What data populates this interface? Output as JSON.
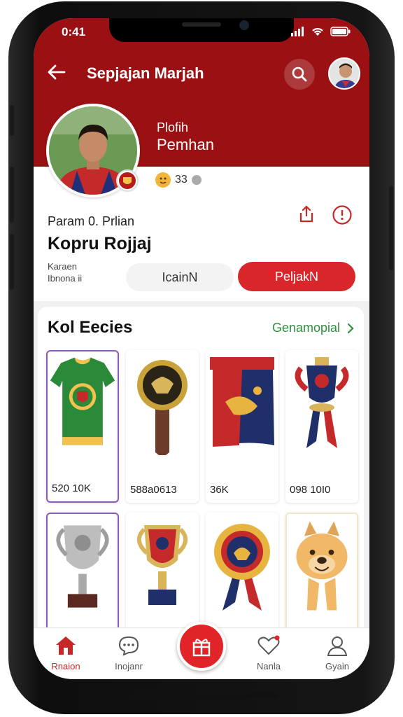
{
  "status_bar": {
    "time": "0:41"
  },
  "header": {
    "title": "Sepjajan Marjah",
    "profile_label": "Plofih",
    "profile_name": "Pemhan"
  },
  "stats": {
    "count": "33"
  },
  "profile": {
    "sub_label": "Param 0. Prlian",
    "name": "Kopru Rojjaj",
    "meta_line1": "Karaen",
    "meta_line2": "Ibnona ii"
  },
  "buttons": {
    "secondary": "IcainN",
    "primary": "PeljakN"
  },
  "collection": {
    "title": "Kol Eecies",
    "link": "Genamopial",
    "items": [
      {
        "price": "520 10K",
        "icon": "jersey-icon"
      },
      {
        "price": "588a0613",
        "icon": "medal-icon"
      },
      {
        "price": "36K",
        "icon": "flag-icon"
      },
      {
        "price": "098 10I0",
        "icon": "trophy-ribbon-icon"
      },
      {
        "price": "",
        "icon": "silver-trophy-icon"
      },
      {
        "price": "",
        "icon": "red-trophy-icon"
      },
      {
        "price": "",
        "icon": "rosette-icon"
      },
      {
        "price": "",
        "icon": "dog-plush-icon"
      }
    ]
  },
  "tabs": [
    {
      "label": "Rnaion",
      "icon": "home-icon"
    },
    {
      "label": "Inojanr",
      "icon": "chat-icon"
    },
    {
      "label": "Nanla",
      "icon": "heart-icon"
    },
    {
      "label": "Gyain",
      "icon": "user-icon"
    }
  ],
  "colors": {
    "brand": "#9b1113",
    "accent": "#d8262b",
    "link": "#2f8f3d"
  }
}
